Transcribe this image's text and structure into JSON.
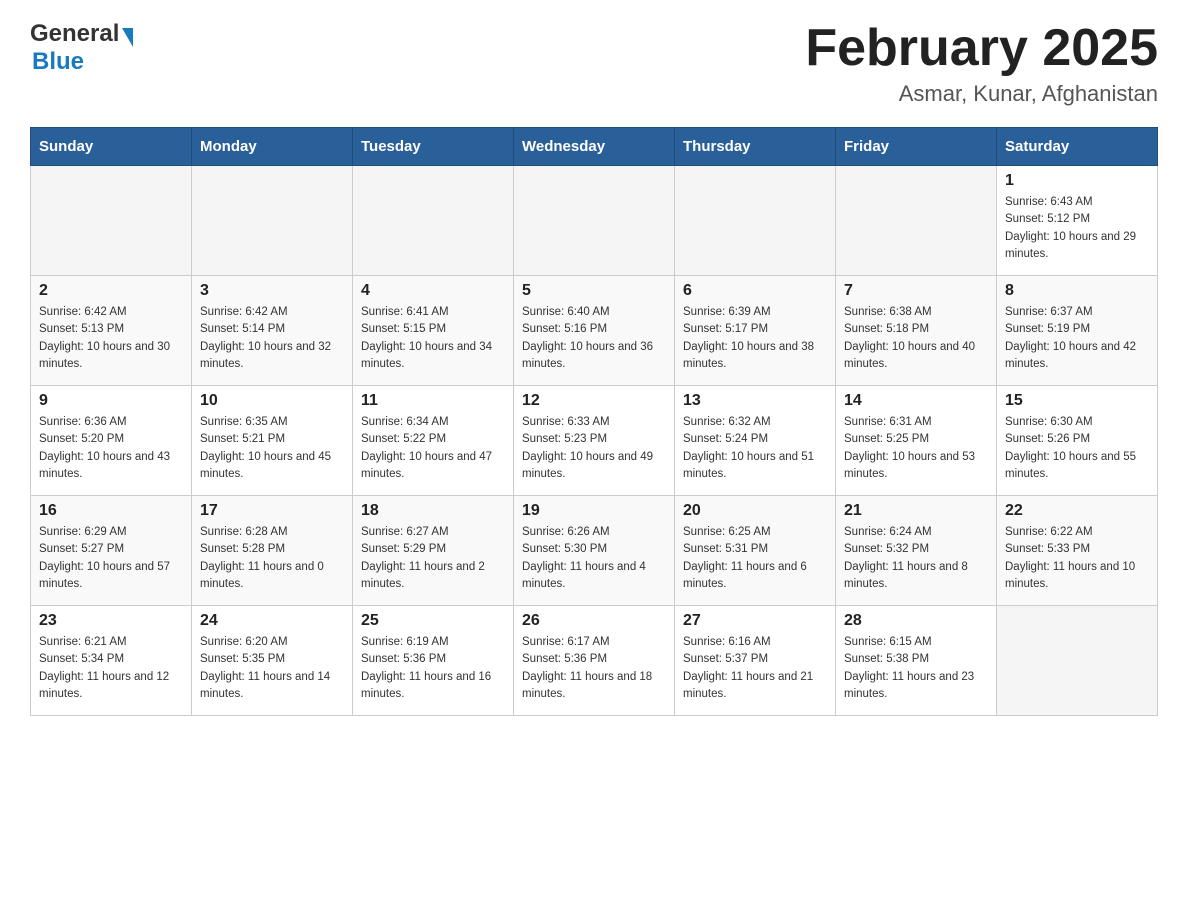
{
  "header": {
    "logo_general": "General",
    "logo_blue": "Blue",
    "title": "February 2025",
    "subtitle": "Asmar, Kunar, Afghanistan"
  },
  "days_of_week": [
    "Sunday",
    "Monday",
    "Tuesday",
    "Wednesday",
    "Thursday",
    "Friday",
    "Saturday"
  ],
  "weeks": [
    {
      "days": [
        {
          "number": "",
          "info": ""
        },
        {
          "number": "",
          "info": ""
        },
        {
          "number": "",
          "info": ""
        },
        {
          "number": "",
          "info": ""
        },
        {
          "number": "",
          "info": ""
        },
        {
          "number": "",
          "info": ""
        },
        {
          "number": "1",
          "info": "Sunrise: 6:43 AM\nSunset: 5:12 PM\nDaylight: 10 hours and 29 minutes."
        }
      ]
    },
    {
      "days": [
        {
          "number": "2",
          "info": "Sunrise: 6:42 AM\nSunset: 5:13 PM\nDaylight: 10 hours and 30 minutes."
        },
        {
          "number": "3",
          "info": "Sunrise: 6:42 AM\nSunset: 5:14 PM\nDaylight: 10 hours and 32 minutes."
        },
        {
          "number": "4",
          "info": "Sunrise: 6:41 AM\nSunset: 5:15 PM\nDaylight: 10 hours and 34 minutes."
        },
        {
          "number": "5",
          "info": "Sunrise: 6:40 AM\nSunset: 5:16 PM\nDaylight: 10 hours and 36 minutes."
        },
        {
          "number": "6",
          "info": "Sunrise: 6:39 AM\nSunset: 5:17 PM\nDaylight: 10 hours and 38 minutes."
        },
        {
          "number": "7",
          "info": "Sunrise: 6:38 AM\nSunset: 5:18 PM\nDaylight: 10 hours and 40 minutes."
        },
        {
          "number": "8",
          "info": "Sunrise: 6:37 AM\nSunset: 5:19 PM\nDaylight: 10 hours and 42 minutes."
        }
      ]
    },
    {
      "days": [
        {
          "number": "9",
          "info": "Sunrise: 6:36 AM\nSunset: 5:20 PM\nDaylight: 10 hours and 43 minutes."
        },
        {
          "number": "10",
          "info": "Sunrise: 6:35 AM\nSunset: 5:21 PM\nDaylight: 10 hours and 45 minutes."
        },
        {
          "number": "11",
          "info": "Sunrise: 6:34 AM\nSunset: 5:22 PM\nDaylight: 10 hours and 47 minutes."
        },
        {
          "number": "12",
          "info": "Sunrise: 6:33 AM\nSunset: 5:23 PM\nDaylight: 10 hours and 49 minutes."
        },
        {
          "number": "13",
          "info": "Sunrise: 6:32 AM\nSunset: 5:24 PM\nDaylight: 10 hours and 51 minutes."
        },
        {
          "number": "14",
          "info": "Sunrise: 6:31 AM\nSunset: 5:25 PM\nDaylight: 10 hours and 53 minutes."
        },
        {
          "number": "15",
          "info": "Sunrise: 6:30 AM\nSunset: 5:26 PM\nDaylight: 10 hours and 55 minutes."
        }
      ]
    },
    {
      "days": [
        {
          "number": "16",
          "info": "Sunrise: 6:29 AM\nSunset: 5:27 PM\nDaylight: 10 hours and 57 minutes."
        },
        {
          "number": "17",
          "info": "Sunrise: 6:28 AM\nSunset: 5:28 PM\nDaylight: 11 hours and 0 minutes."
        },
        {
          "number": "18",
          "info": "Sunrise: 6:27 AM\nSunset: 5:29 PM\nDaylight: 11 hours and 2 minutes."
        },
        {
          "number": "19",
          "info": "Sunrise: 6:26 AM\nSunset: 5:30 PM\nDaylight: 11 hours and 4 minutes."
        },
        {
          "number": "20",
          "info": "Sunrise: 6:25 AM\nSunset: 5:31 PM\nDaylight: 11 hours and 6 minutes."
        },
        {
          "number": "21",
          "info": "Sunrise: 6:24 AM\nSunset: 5:32 PM\nDaylight: 11 hours and 8 minutes."
        },
        {
          "number": "22",
          "info": "Sunrise: 6:22 AM\nSunset: 5:33 PM\nDaylight: 11 hours and 10 minutes."
        }
      ]
    },
    {
      "days": [
        {
          "number": "23",
          "info": "Sunrise: 6:21 AM\nSunset: 5:34 PM\nDaylight: 11 hours and 12 minutes."
        },
        {
          "number": "24",
          "info": "Sunrise: 6:20 AM\nSunset: 5:35 PM\nDaylight: 11 hours and 14 minutes."
        },
        {
          "number": "25",
          "info": "Sunrise: 6:19 AM\nSunset: 5:36 PM\nDaylight: 11 hours and 16 minutes."
        },
        {
          "number": "26",
          "info": "Sunrise: 6:17 AM\nSunset: 5:36 PM\nDaylight: 11 hours and 18 minutes."
        },
        {
          "number": "27",
          "info": "Sunrise: 6:16 AM\nSunset: 5:37 PM\nDaylight: 11 hours and 21 minutes."
        },
        {
          "number": "28",
          "info": "Sunrise: 6:15 AM\nSunset: 5:38 PM\nDaylight: 11 hours and 23 minutes."
        },
        {
          "number": "",
          "info": ""
        }
      ]
    }
  ]
}
